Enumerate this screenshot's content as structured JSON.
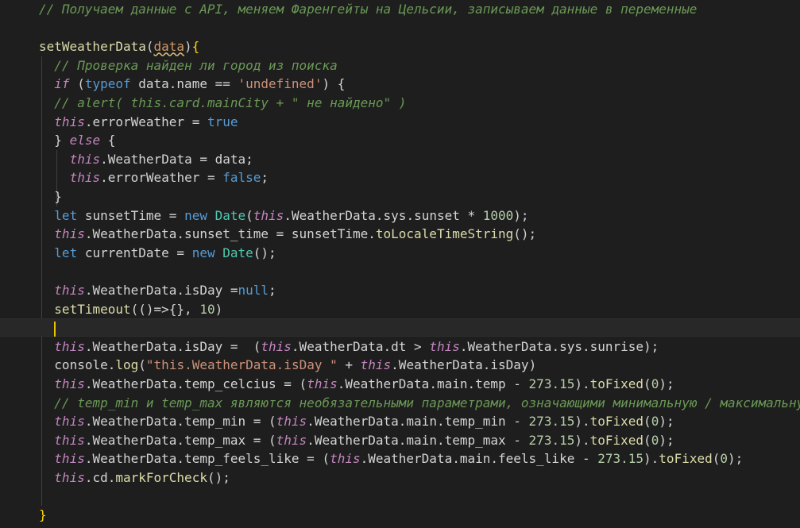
{
  "editor": {
    "theme": {
      "background": "#1e1e1e",
      "comment": "#6a9955",
      "keyword": "#569cd6",
      "function": "#dcdcaa",
      "string": "#ce9178",
      "number": "#b5cea8",
      "this": "#c586c0",
      "class": "#4ec9b0"
    },
    "lines": [
      [
        [
          "cm",
          "// Получаем данные с API, меняем Фаренгейты на Цельсии, записываем данные в переменные"
        ]
      ],
      [],
      [
        [
          "fn",
          "setWeatherData"
        ],
        [
          "pl",
          "("
        ],
        [
          "prm",
          "data"
        ],
        [
          "pl",
          ")"
        ],
        [
          "br",
          "{"
        ]
      ],
      [
        [
          "cm",
          "// Проверка найден ли город из поиска"
        ]
      ],
      [
        [
          "ctl",
          "if"
        ],
        [
          "pl",
          " ("
        ],
        [
          "kw",
          "typeof"
        ],
        [
          "pl",
          " data.name == "
        ],
        [
          "str",
          "'undefined'"
        ],
        [
          "pl",
          ") {"
        ]
      ],
      [
        [
          "cm",
          "// alert( this.card.mainCity + \" не найдено\" )"
        ]
      ],
      [
        [
          "th",
          "this"
        ],
        [
          "pl",
          ".errorWeather = "
        ],
        [
          "bool",
          "true"
        ]
      ],
      [
        [
          "pl",
          "} "
        ],
        [
          "ctl",
          "else"
        ],
        [
          "pl",
          " {"
        ]
      ],
      [
        [
          "th",
          "this"
        ],
        [
          "pl",
          ".WeatherData = data;"
        ]
      ],
      [
        [
          "th",
          "this"
        ],
        [
          "pl",
          ".errorWeather = "
        ],
        [
          "bool",
          "false"
        ],
        [
          "pl",
          ";"
        ]
      ],
      [
        [
          "pl",
          "}"
        ]
      ],
      [
        [
          "kw",
          "let"
        ],
        [
          "pl",
          " sunsetTime = "
        ],
        [
          "kw",
          "new"
        ],
        [
          "pl",
          " "
        ],
        [
          "cls",
          "Date"
        ],
        [
          "pl",
          "("
        ],
        [
          "th",
          "this"
        ],
        [
          "pl",
          ".WeatherData.sys.sunset * "
        ],
        [
          "num",
          "1000"
        ],
        [
          "pl",
          ");"
        ]
      ],
      [
        [
          "th",
          "this"
        ],
        [
          "pl",
          ".WeatherData.sunset_time = sunsetTime."
        ],
        [
          "mth",
          "toLocaleTimeString"
        ],
        [
          "pl",
          "();"
        ]
      ],
      [
        [
          "kw",
          "let"
        ],
        [
          "pl",
          " currentDate = "
        ],
        [
          "kw",
          "new"
        ],
        [
          "pl",
          " "
        ],
        [
          "cls",
          "Date"
        ],
        [
          "pl",
          "();"
        ]
      ],
      [],
      [
        [
          "th",
          "this"
        ],
        [
          "pl",
          ".WeatherData.isDay ="
        ],
        [
          "bool",
          "null"
        ],
        [
          "pl",
          ";"
        ]
      ],
      [
        [
          "mth",
          "setTimeout"
        ],
        [
          "pl",
          "(()=>{}, "
        ],
        [
          "num",
          "10"
        ],
        [
          "pl",
          ")"
        ]
      ],
      [],
      [
        [
          "th",
          "this"
        ],
        [
          "pl",
          ".WeatherData.isDay =  ("
        ],
        [
          "th",
          "this"
        ],
        [
          "pl",
          ".WeatherData.dt > "
        ],
        [
          "th",
          "this"
        ],
        [
          "pl",
          ".WeatherData.sys.sunrise);"
        ]
      ],
      [
        [
          "pl",
          "console."
        ],
        [
          "mth",
          "log"
        ],
        [
          "pl",
          "("
        ],
        [
          "str",
          "\""
        ],
        [
          "str",
          "this.WeatherData.isDay \""
        ],
        [
          "pl",
          " + "
        ],
        [
          "th",
          "this"
        ],
        [
          "pl",
          ".WeatherData.isDay)"
        ]
      ],
      [
        [
          "th",
          "this"
        ],
        [
          "pl",
          ".WeatherData.temp_celcius = ("
        ],
        [
          "th",
          "this"
        ],
        [
          "pl",
          ".WeatherData.main.temp - "
        ],
        [
          "num",
          "273.15"
        ],
        [
          "pl",
          ")."
        ],
        [
          "mth",
          "toFixed"
        ],
        [
          "pl",
          "("
        ],
        [
          "num",
          "0"
        ],
        [
          "pl",
          ");"
        ]
      ],
      [
        [
          "cm",
          "// temp_min и temp_max являются необязательными параметрами, означающими минимальную / максимальную"
        ]
      ],
      [
        [
          "th",
          "this"
        ],
        [
          "pl",
          ".WeatherData.temp_min = ("
        ],
        [
          "th",
          "this"
        ],
        [
          "pl",
          ".WeatherData.main.temp_min - "
        ],
        [
          "num",
          "273.15"
        ],
        [
          "pl",
          ")."
        ],
        [
          "mth",
          "toFixed"
        ],
        [
          "pl",
          "("
        ],
        [
          "num",
          "0"
        ],
        [
          "pl",
          ");"
        ]
      ],
      [
        [
          "th",
          "this"
        ],
        [
          "pl",
          ".WeatherData.temp_max = ("
        ],
        [
          "th",
          "this"
        ],
        [
          "pl",
          ".WeatherData.main.temp_max - "
        ],
        [
          "num",
          "273.15"
        ],
        [
          "pl",
          ")."
        ],
        [
          "mth",
          "toFixed"
        ],
        [
          "pl",
          "("
        ],
        [
          "num",
          "0"
        ],
        [
          "pl",
          ");"
        ]
      ],
      [
        [
          "th",
          "this"
        ],
        [
          "pl",
          ".WeatherData.temp_feels_like = ("
        ],
        [
          "th",
          "this"
        ],
        [
          "pl",
          ".WeatherData.main.feels_like - "
        ],
        [
          "num",
          "273.15"
        ],
        [
          "pl",
          ")."
        ],
        [
          "mth",
          "toFixed"
        ],
        [
          "pl",
          "("
        ],
        [
          "num",
          "0"
        ],
        [
          "pl",
          ");"
        ]
      ],
      [
        [
          "th",
          "this"
        ],
        [
          "pl",
          ".cd."
        ],
        [
          "mth",
          "markForCheck"
        ],
        [
          "pl",
          "();"
        ]
      ],
      [],
      [
        [
          "br",
          "}"
        ]
      ]
    ]
  }
}
